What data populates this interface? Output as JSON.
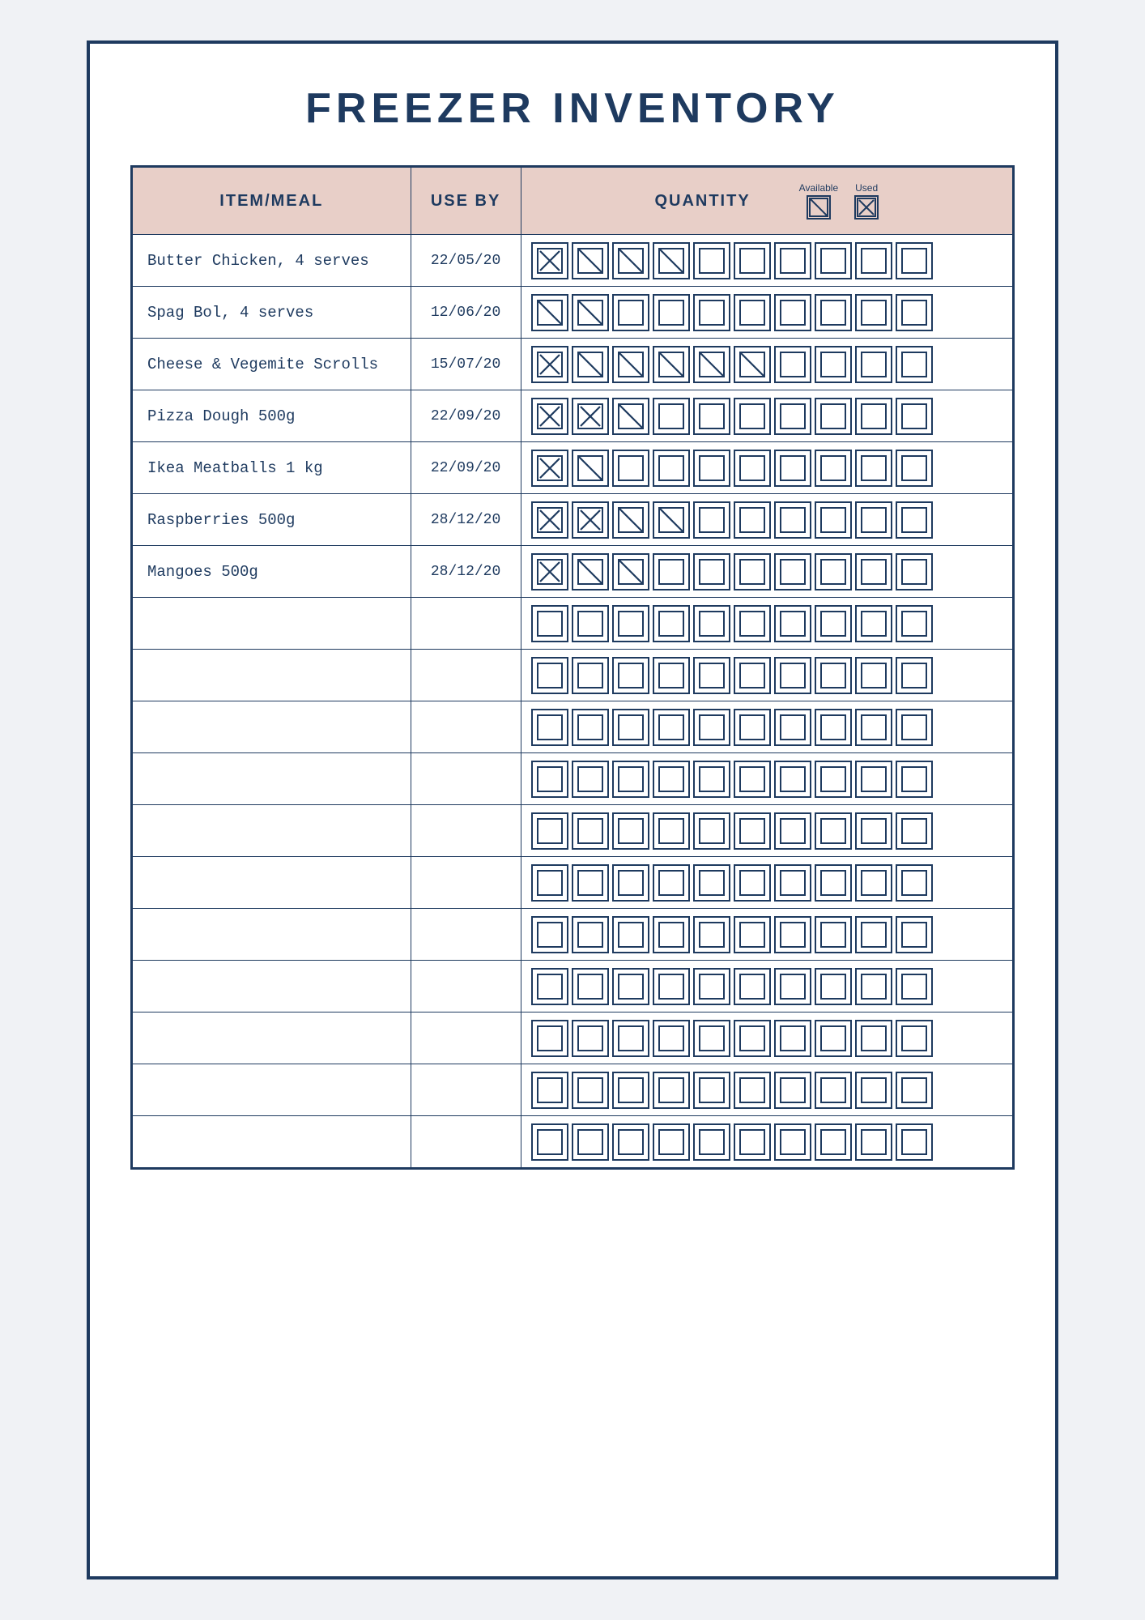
{
  "page": {
    "title": "FREEZER INVENTORY",
    "background_color": "#ffffff",
    "border_color": "#1e3a5f"
  },
  "header": {
    "col1_label": "ITEM/MEAL",
    "col2_label": "USE BY",
    "col3_label": "QUANTITY",
    "legend_available_label": "Available",
    "legend_used_label": "Used",
    "legend_available_symbol": "✓",
    "legend_used_symbol": "✗"
  },
  "rows": [
    {
      "item": "Butter Chicken, 4 serves",
      "use_by": "22/05/20",
      "boxes": [
        "X",
        "C",
        "C",
        "C",
        "",
        "",
        "",
        "",
        "",
        ""
      ]
    },
    {
      "item": "Spag Bol, 4 serves",
      "use_by": "12/06/20",
      "boxes": [
        "C",
        "C",
        "",
        "",
        "",
        "",
        "",
        "",
        "",
        ""
      ]
    },
    {
      "item": "Cheese & Vegemite Scrolls",
      "use_by": "15/07/20",
      "boxes": [
        "X",
        "C",
        "C",
        "C",
        "C",
        "C",
        "",
        "",
        "",
        ""
      ]
    },
    {
      "item": "Pizza Dough 500g",
      "use_by": "22/09/20",
      "boxes": [
        "X",
        "X",
        "C",
        "",
        "",
        "",
        "",
        "",
        "",
        ""
      ]
    },
    {
      "item": "Ikea Meatballs 1 kg",
      "use_by": "22/09/20",
      "boxes": [
        "X",
        "C",
        "",
        "",
        "",
        "",
        "",
        "",
        "",
        ""
      ]
    },
    {
      "item": "Raspberries 500g",
      "use_by": "28/12/20",
      "boxes": [
        "X",
        "X",
        "C",
        "C",
        "",
        "",
        "",
        "",
        "",
        ""
      ]
    },
    {
      "item": "Mangoes 500g",
      "use_by": "28/12/20",
      "boxes": [
        "X",
        "C",
        "C",
        "",
        "",
        "",
        "",
        "",
        "",
        ""
      ]
    },
    {
      "item": "",
      "use_by": "",
      "boxes": [
        "",
        "",
        "",
        "",
        "",
        "",
        "",
        "",
        "",
        ""
      ]
    },
    {
      "item": "",
      "use_by": "",
      "boxes": [
        "",
        "",
        "",
        "",
        "",
        "",
        "",
        "",
        "",
        ""
      ]
    },
    {
      "item": "",
      "use_by": "",
      "boxes": [
        "",
        "",
        "",
        "",
        "",
        "",
        "",
        "",
        "",
        ""
      ]
    },
    {
      "item": "",
      "use_by": "",
      "boxes": [
        "",
        "",
        "",
        "",
        "",
        "",
        "",
        "",
        "",
        ""
      ]
    },
    {
      "item": "",
      "use_by": "",
      "boxes": [
        "",
        "",
        "",
        "",
        "",
        "",
        "",
        "",
        "",
        ""
      ]
    },
    {
      "item": "",
      "use_by": "",
      "boxes": [
        "",
        "",
        "",
        "",
        "",
        "",
        "",
        "",
        "",
        ""
      ]
    },
    {
      "item": "",
      "use_by": "",
      "boxes": [
        "",
        "",
        "",
        "",
        "",
        "",
        "",
        "",
        "",
        ""
      ]
    },
    {
      "item": "",
      "use_by": "",
      "boxes": [
        "",
        "",
        "",
        "",
        "",
        "",
        "",
        "",
        "",
        ""
      ]
    },
    {
      "item": "",
      "use_by": "",
      "boxes": [
        "",
        "",
        "",
        "",
        "",
        "",
        "",
        "",
        "",
        ""
      ]
    },
    {
      "item": "",
      "use_by": "",
      "boxes": [
        "",
        "",
        "",
        "",
        "",
        "",
        "",
        "",
        "",
        ""
      ]
    },
    {
      "item": "",
      "use_by": "",
      "boxes": [
        "",
        "",
        "",
        "",
        "",
        "",
        "",
        "",
        "",
        ""
      ]
    }
  ]
}
